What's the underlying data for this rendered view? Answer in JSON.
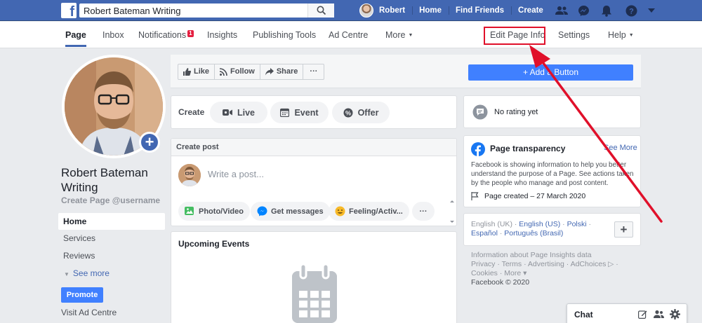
{
  "topbar": {
    "logo": "f",
    "search_value": "Robert Bateman Writing",
    "profile_name": "Robert",
    "links": [
      "Home",
      "Find Friends",
      "Create"
    ]
  },
  "pagenav": {
    "items": [
      "Page",
      "Inbox",
      "Notifications",
      "Insights",
      "Publishing Tools",
      "Ad Centre",
      "More",
      "Edit Page Info",
      "Settings",
      "Help"
    ],
    "notification_count": "1"
  },
  "left": {
    "page_name": "Robert Bateman Writing",
    "username": "Create Page @username",
    "nav": [
      "Home",
      "Services",
      "Reviews",
      "See more"
    ],
    "promote": "Promote",
    "visit_ad": "Visit Ad Centre"
  },
  "actions": {
    "like": "Like",
    "follow": "Follow",
    "share": "Share",
    "more": "···",
    "add_button": "+ Add a Button"
  },
  "create": {
    "label": "Create",
    "live": "Live",
    "event": "Event",
    "offer": "Offer"
  },
  "post": {
    "header": "Create post",
    "placeholder": "Write a post...",
    "photo": "Photo/Video",
    "messages": "Get messages",
    "feeling": "Feeling/Activ...",
    "more": "···"
  },
  "events": {
    "title": "Upcoming Events"
  },
  "right": {
    "rating": "No rating yet",
    "transparency_title": "Page transparency",
    "see_more": "See More",
    "transparency_text": "Facebook is showing information to help you better understand the purpose of a Page. See actions taken by the people who manage and post content.",
    "page_created": "Page created – 27 March 2020",
    "languages_line1": [
      "English (UK)",
      "English (US)",
      "Polski"
    ],
    "languages_line2": [
      "Español",
      "Português (Brasil)"
    ],
    "footer_line1": "Information about Page Insights data",
    "footer_line2": "Privacy · Terms · Advertising · AdChoices ▷ ·",
    "footer_line3": "Cookies · More ▾",
    "footer_line4": "Facebook © 2020"
  },
  "chat": {
    "label": "Chat"
  },
  "colors": {
    "brand": "#4267b2",
    "button": "#4080ff",
    "annotation": "#e0102a"
  }
}
